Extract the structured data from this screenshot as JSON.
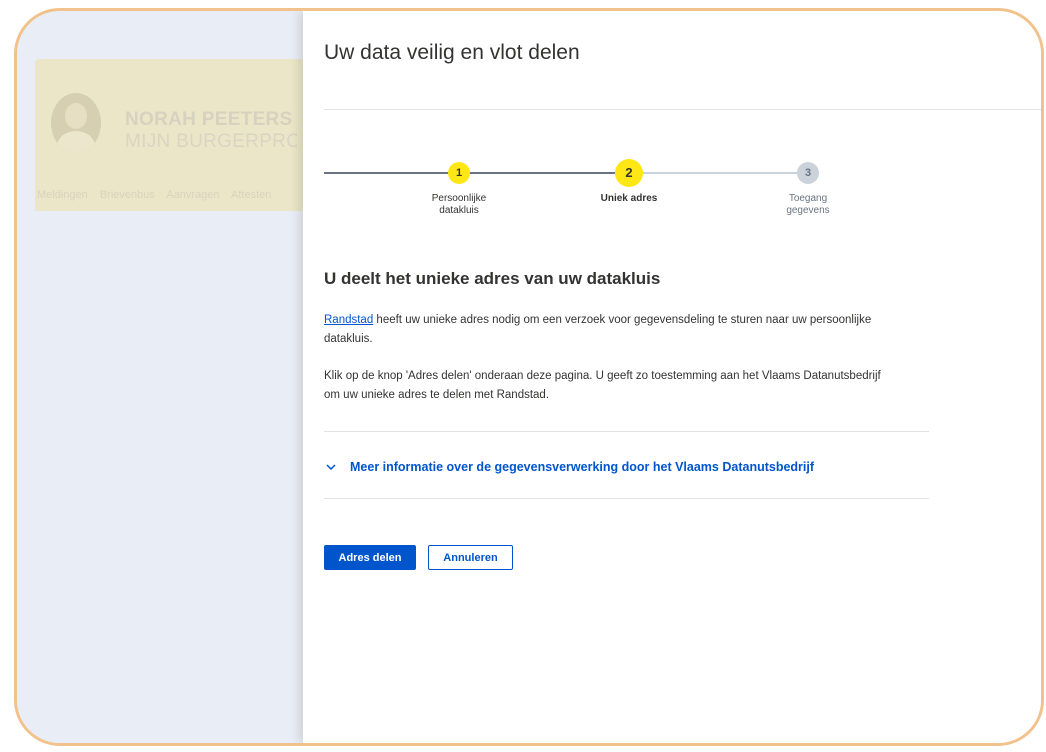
{
  "background_page": {
    "name": "NORAH PEETERS",
    "subtitle": "MIJN BURGERPROFIEL",
    "nav": [
      "Meldingen",
      "Brievenbus",
      "Aanvragen",
      "Attesten"
    ]
  },
  "modal": {
    "title": "Uw data veilig en vlot delen"
  },
  "stepper": {
    "steps": [
      {
        "number": "1",
        "label_line1": "Persoonlijke",
        "label_line2": "datakluis",
        "state": "done"
      },
      {
        "number": "2",
        "label_line1": "Uniek adres",
        "label_line2": "",
        "state": "active"
      },
      {
        "number": "3",
        "label_line1": "Toegang",
        "label_line2": "gegevens",
        "state": "upcoming"
      }
    ]
  },
  "content": {
    "heading": "U deelt het unieke adres van uw datakluis",
    "para1_link": "Randstad",
    "para1_rest": " heeft uw unieke adres nodig om een verzoek voor gegevensdeling te sturen naar uw persoonlijke datakluis.",
    "para2": "Klik op de knop 'Adres delen' onderaan deze pagina. U geeft zo toestemming aan het Vlaams Datanutsbedrijf om uw unieke adres te delen met Randstad.",
    "accordion_label": "Meer informatie over de gegevensverwerking door het Vlaams Datanutsbedrijf"
  },
  "buttons": {
    "primary": "Adres delen",
    "secondary": "Annuleren"
  },
  "colors": {
    "accent": "#0055cc",
    "step_yellow": "#ffe615",
    "frame": "#f2c28c"
  }
}
